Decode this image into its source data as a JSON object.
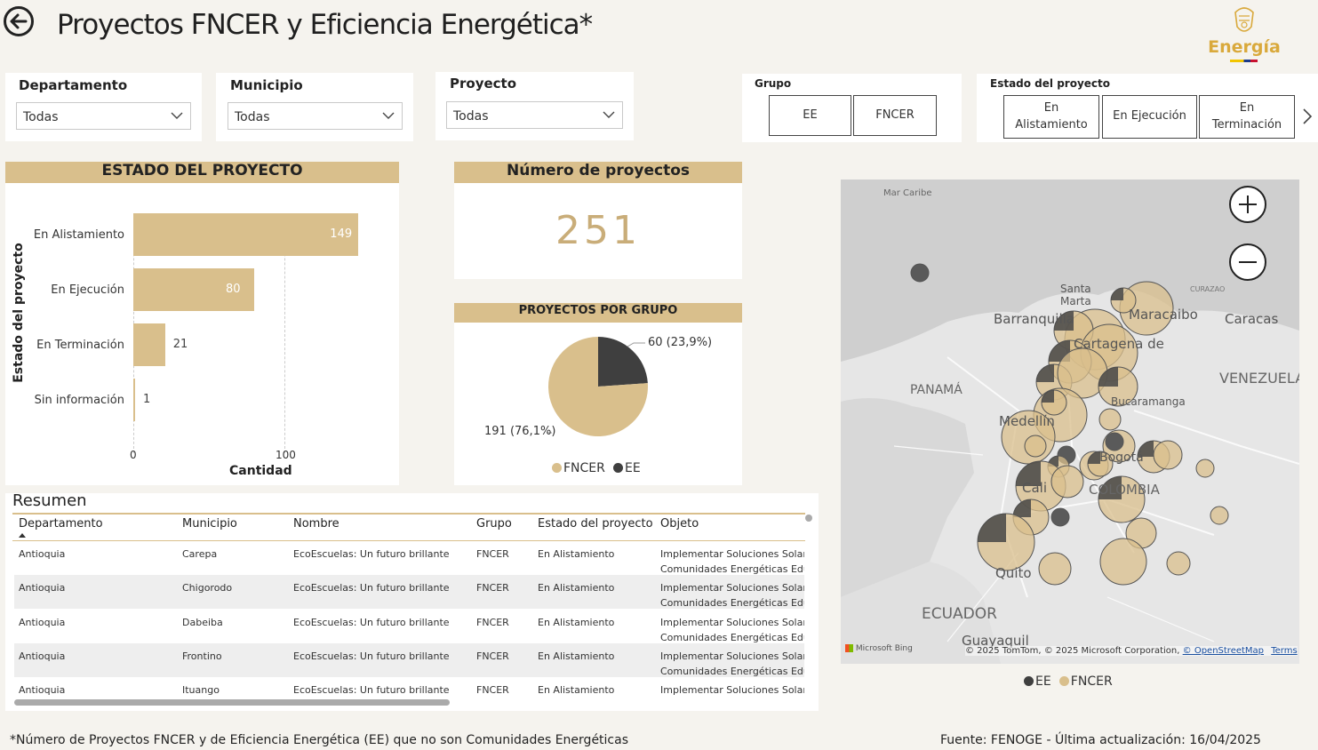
{
  "header": {
    "title": "Proyectos FNCER y Eficiencia Energética*",
    "logo_text": "Energía"
  },
  "filters": {
    "departamento": {
      "label": "Departamento",
      "value": "Todas"
    },
    "municipio": {
      "label": "Municipio",
      "value": "Todas"
    },
    "proyecto": {
      "label": "Proyecto",
      "value": "Todas"
    },
    "grupo": {
      "label": "Grupo",
      "options": [
        "EE",
        "FNCER"
      ]
    },
    "estado": {
      "label": "Estado del proyecto",
      "options": [
        "En\nAlistamiento",
        "En Ejecución",
        "En\nTerminación"
      ]
    }
  },
  "estado_chart": {
    "title": "ESTADO DEL PROYECTO",
    "ylabel": "Estado del proyecto",
    "xlabel": "Cantidad",
    "ticks": [
      "0",
      "100"
    ]
  },
  "kpi": {
    "title": "Número de proyectos",
    "value": "251"
  },
  "grupo_chart": {
    "title": "PROYECTOS POR GRUPO",
    "label_ee": "60 (23,9%)",
    "label_fncer": "191 (76,1%)",
    "legend_fncer": "FNCER",
    "legend_ee": "EE"
  },
  "chart_data": [
    {
      "type": "bar",
      "orientation": "horizontal",
      "title": "ESTADO DEL PROYECTO",
      "categories": [
        "En Alistamiento",
        "En Ejecución",
        "En Terminación",
        "Sin información"
      ],
      "values": [
        149,
        80,
        21,
        1
      ],
      "xlabel": "Cantidad",
      "ylabel": "Estado del proyecto",
      "xlim": [
        0,
        175
      ],
      "color": "#d9bf8c"
    },
    {
      "type": "pie",
      "title": "PROYECTOS POR GRUPO",
      "categories": [
        "FNCER",
        "EE"
      ],
      "values": [
        191,
        60
      ],
      "colors": [
        "#d9bf8c",
        "#3f3f3f"
      ],
      "legend": "bottom"
    }
  ],
  "map": {
    "labels": {
      "mar_caribe": "Mar Caribe",
      "santa_marta": "Santa Marta",
      "barranquilla": "Barranquilla",
      "maracaibo": "Maracaibo",
      "caracas": "Caracas",
      "curazao": "CURAZAO",
      "cartagena": "Cartagena de",
      "panama": "PANAMÁ",
      "venezuela": "VENEZUELA",
      "bucaramanga": "Bucaramanga",
      "medellin": "Medellín",
      "bogota": "Bogotá",
      "cali": "Cali",
      "colombia": "COLOMBIA",
      "quito": "Quito",
      "ecuador": "ECUADOR",
      "guayaquil": "Guayaquil"
    },
    "attribution_bing": "Microsoft Bing",
    "attribution": "© 2025 TomTom, © 2025 Microsoft Corporation,",
    "osm": "© OpenStreetMap",
    "terms": "Terms",
    "legend_ee": "EE",
    "legend_fncer": "FNCER"
  },
  "table": {
    "title": "Resumen",
    "headers": [
      "Departamento",
      "Municipio",
      "Nombre",
      "Grupo",
      "Estado del proyecto",
      "Objeto"
    ],
    "rows": [
      {
        "dep": "Antioquia",
        "mun": "Carepa",
        "nombre": "EcoEscuelas: Un futuro brillante",
        "grupo": "FNCER",
        "estado": "En Alistamiento",
        "obj1": "Implementar Soluciones Solar",
        "obj2": "Comunidades Energéticas Edu"
      },
      {
        "dep": "Antioquia",
        "mun": "Chigorodo",
        "nombre": "EcoEscuelas: Un futuro brillante",
        "grupo": "FNCER",
        "estado": "En Alistamiento",
        "obj1": "Implementar Soluciones Solar",
        "obj2": "Comunidades Energéticas Edu"
      },
      {
        "dep": "Antioquia",
        "mun": "Dabeiba",
        "nombre": "EcoEscuelas: Un futuro brillante",
        "grupo": "FNCER",
        "estado": "En Alistamiento",
        "obj1": "Implementar Soluciones Solar",
        "obj2": "Comunidades Energéticas Edu"
      },
      {
        "dep": "Antioquia",
        "mun": "Frontino",
        "nombre": "EcoEscuelas: Un futuro brillante",
        "grupo": "FNCER",
        "estado": "En Alistamiento",
        "obj1": "Implementar Soluciones Solar",
        "obj2": "Comunidades Energéticas Edu"
      },
      {
        "dep": "Antioquia",
        "mun": "Ituango",
        "nombre": "EcoEscuelas: Un futuro brillante",
        "grupo": "FNCER",
        "estado": "En Alistamiento",
        "obj1": "Implementar Soluciones Solar",
        "obj2": ""
      }
    ]
  },
  "footer": {
    "note": "*Número de Proyectos FNCER y de Eficiencia Energética (EE) que no son Comunidades Energéticas",
    "source": "Fuente: FENOGE - Última actualización: 16/04/2025"
  },
  "colors": {
    "gold": "#d9bf8c",
    "dark": "#3f3f3f",
    "kpi": "#c9ad79",
    "background": "#f5f3ee"
  }
}
